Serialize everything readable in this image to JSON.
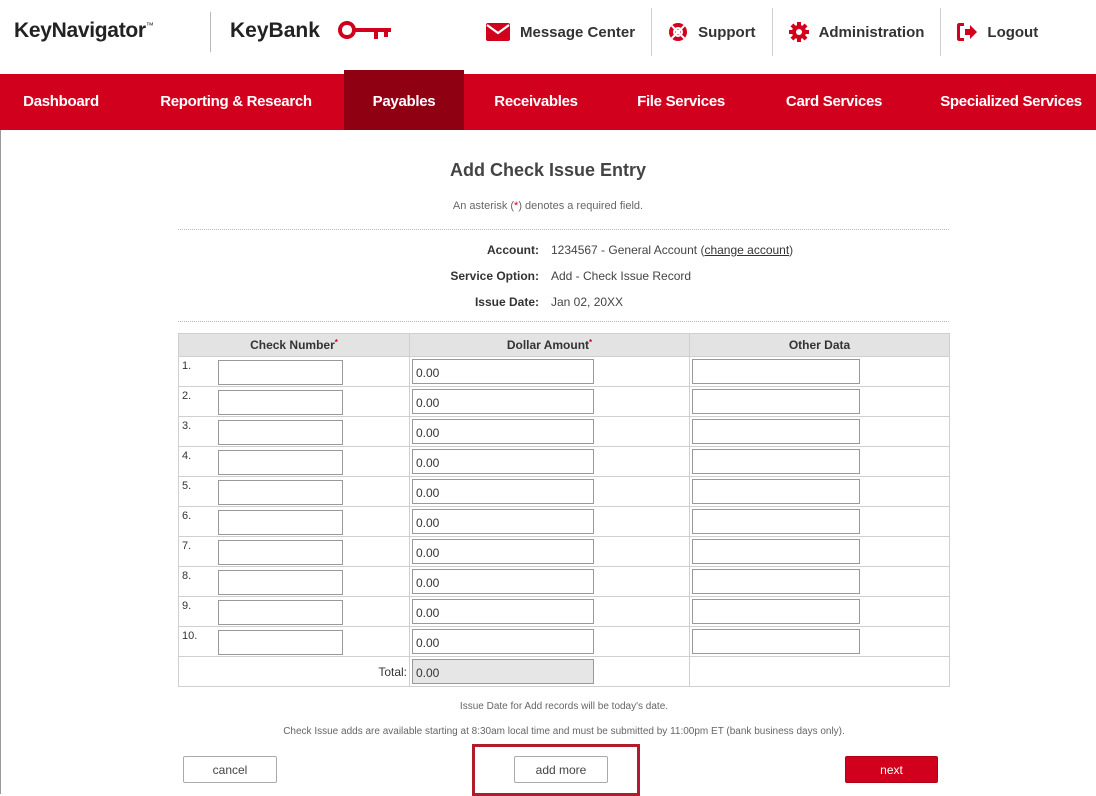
{
  "brand": {
    "keynavigator": "KeyNavigator",
    "tm": "™",
    "keybank": "KeyBank",
    "brand_red": "#d1001c",
    "nav_active": "#8f0012"
  },
  "top_links": [
    {
      "label": "Message Center",
      "icon": "envelope-icon"
    },
    {
      "label": "Support",
      "icon": "lifebuoy-icon"
    },
    {
      "label": "Administration",
      "icon": "gear-icon"
    },
    {
      "label": "Logout",
      "icon": "logout-icon"
    }
  ],
  "nav": [
    {
      "label": "Dashboard",
      "active": false
    },
    {
      "label": "Reporting & Research",
      "active": false
    },
    {
      "label": "Payables",
      "active": true
    },
    {
      "label": "Receivables",
      "active": false
    },
    {
      "label": "File Services",
      "active": false
    },
    {
      "label": "Card Services",
      "active": false
    },
    {
      "label": "Specialized Services",
      "active": false
    }
  ],
  "page": {
    "title": "Add Check Issue Entry",
    "required_note_pre": "An asterisk (",
    "required_note_ast": "*",
    "required_note_post": ") denotes a required field."
  },
  "info": {
    "account_label": "Account:",
    "account_value": "1234567 - General Account (",
    "change_account": "change account",
    "account_close": ")",
    "service_label": "Service Option:",
    "service_value": "Add - Check Issue Record",
    "date_label": "Issue Date:",
    "date_value": "Jan 02, 20XX"
  },
  "table": {
    "headers": {
      "check_number": "Check Number",
      "dollar_amount": "Dollar Amount",
      "other_data": "Other Data",
      "req_mark": "*"
    },
    "rows": [
      {
        "num": "1.",
        "check": "",
        "amount": "0.00",
        "other": ""
      },
      {
        "num": "2.",
        "check": "",
        "amount": "0.00",
        "other": ""
      },
      {
        "num": "3.",
        "check": "",
        "amount": "0.00",
        "other": ""
      },
      {
        "num": "4.",
        "check": "",
        "amount": "0.00",
        "other": ""
      },
      {
        "num": "5.",
        "check": "",
        "amount": "0.00",
        "other": ""
      },
      {
        "num": "6.",
        "check": "",
        "amount": "0.00",
        "other": ""
      },
      {
        "num": "7.",
        "check": "",
        "amount": "0.00",
        "other": ""
      },
      {
        "num": "8.",
        "check": "",
        "amount": "0.00",
        "other": ""
      },
      {
        "num": "9.",
        "check": "",
        "amount": "0.00",
        "other": ""
      },
      {
        "num": "10.",
        "check": "",
        "amount": "0.00",
        "other": ""
      }
    ],
    "total_label": "Total:",
    "total_value": "0.00"
  },
  "footnotes": {
    "line1": "Issue Date for Add records will be today's date.",
    "line2": "Check Issue adds are available starting at 8:30am local time and must be submitted by 11:00pm ET (bank business days only)."
  },
  "buttons": {
    "cancel": "cancel",
    "add_more": "add more",
    "next": "next"
  }
}
